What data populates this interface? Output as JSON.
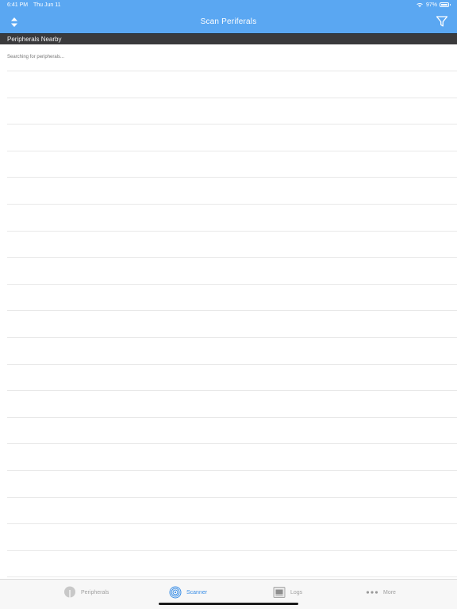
{
  "status_bar": {
    "time": "6:41 PM",
    "date": "Thu Jun 11",
    "battery_pct": "97%",
    "battery_level": 0.97,
    "wifi_icon": "wifi-icon",
    "battery_icon": "battery-icon"
  },
  "nav": {
    "title": "Scan Periferals",
    "left_icon": "sort-arrows-icon",
    "right_icon": "filter-funnel-icon"
  },
  "section": {
    "title": "Peripherals Nearby"
  },
  "list": {
    "status_text": "Searching for peripherals..."
  },
  "tabs": [
    {
      "label": "Peripherals",
      "icon": "peripherals-icon",
      "active": false
    },
    {
      "label": "Scanner",
      "icon": "scanner-target-icon",
      "active": true
    },
    {
      "label": "Logs",
      "icon": "logs-icon",
      "active": false
    },
    {
      "label": "More",
      "icon": "more-dots-icon",
      "active": false
    }
  ],
  "colors": {
    "nav_bg": "#5aa7f2",
    "section_bg": "#3a3a3c",
    "accent": "#3a8ee6",
    "tab_inactive": "#a0a0a0"
  }
}
